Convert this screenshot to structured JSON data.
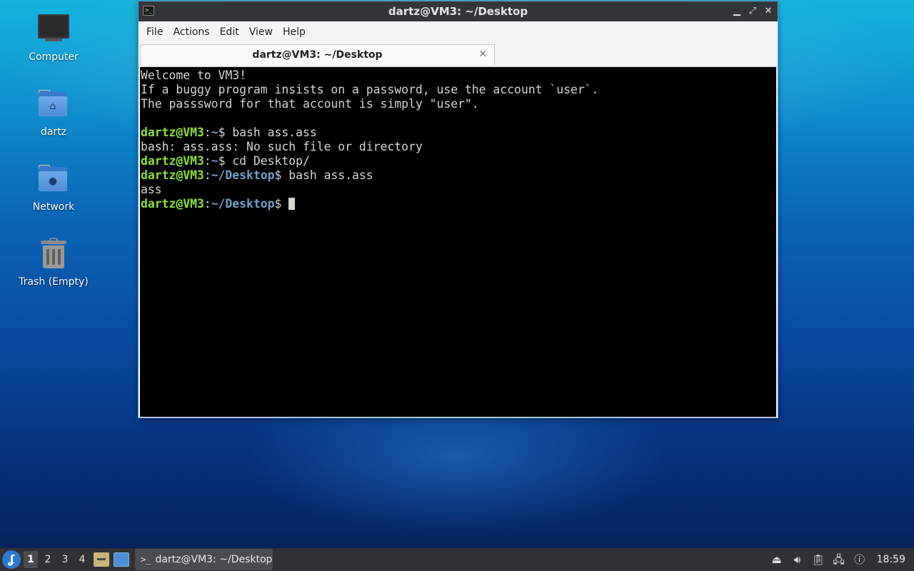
{
  "desktop": {
    "icons": [
      {
        "label": "Computer",
        "icon": "monitor-icon"
      },
      {
        "label": "dartz",
        "icon": "home-folder-icon"
      },
      {
        "label": "Network",
        "icon": "network-folder-icon"
      },
      {
        "label": "Trash (Empty)",
        "icon": "trash-icon"
      }
    ]
  },
  "window": {
    "title": "dartz@VM3: ~/Desktop",
    "controls": {
      "minimize": "▁",
      "maximize": "⤢",
      "close": "✕"
    },
    "menu": [
      "File",
      "Actions",
      "Edit",
      "View",
      "Help"
    ],
    "tab": {
      "label": "dartz@VM3: ~/Desktop",
      "close": "✕"
    }
  },
  "terminal": {
    "welcome": [
      "Welcome to VM3!",
      "If a buggy program insists on a password, use the account `user`.",
      "The passsword for that account is simply \"user\"."
    ],
    "prompt_user": "dartz@VM3",
    "sessions": [
      {
        "path": "~",
        "command": "bash ass.ass"
      },
      {
        "output": "bash: ass.ass: No such file or directory"
      },
      {
        "path": "~",
        "command": "cd Desktop/"
      },
      {
        "path": "~/Desktop",
        "command": "bash ass.ass"
      },
      {
        "output": "ass"
      },
      {
        "path": "~/Desktop",
        "command": ""
      }
    ],
    "colors": {
      "user": "#8ae234",
      "path": "#729fcf",
      "text": "#d3d7cf",
      "background": "#000000"
    }
  },
  "taskbar": {
    "workspaces": [
      "1",
      "2",
      "3",
      "4"
    ],
    "active_workspace": "1",
    "task_label": "dartz@VM3: ~/Desktop",
    "tray_icons": [
      "eject-icon",
      "volume-icon",
      "clipboard-icon",
      "network-icon",
      "notification-icon"
    ],
    "clock": "18:59"
  }
}
